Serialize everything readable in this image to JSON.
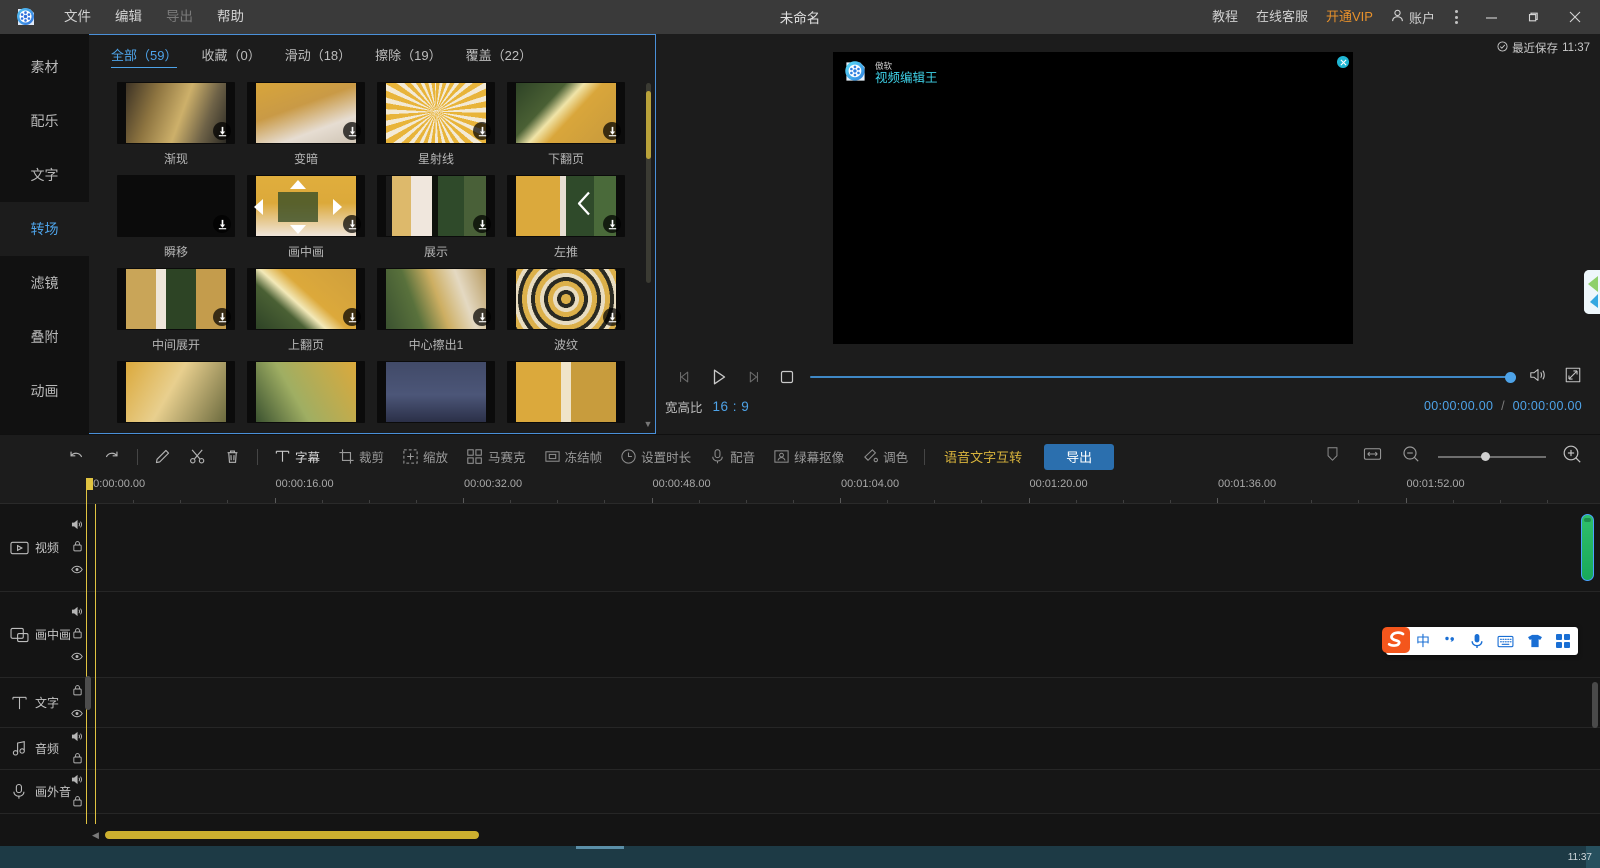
{
  "titlebar": {
    "app_title": "未命名",
    "menus": [
      {
        "label": "文件",
        "disabled": false
      },
      {
        "label": "编辑",
        "disabled": false
      },
      {
        "label": "导出",
        "disabled": true
      },
      {
        "label": "帮助",
        "disabled": false
      }
    ],
    "right": {
      "tutorial": "教程",
      "support": "在线客服",
      "vip": "开通VIP",
      "account": "账户",
      "vip_color": "#e8912b"
    }
  },
  "save_status": {
    "label": "最近保存",
    "time": "11:37"
  },
  "sidebar": {
    "items": [
      {
        "label": "素材",
        "active": false
      },
      {
        "label": "配乐",
        "active": false
      },
      {
        "label": "文字",
        "active": false
      },
      {
        "label": "转场",
        "active": true
      },
      {
        "label": "滤镜",
        "active": false
      },
      {
        "label": "叠附",
        "active": false
      },
      {
        "label": "动画",
        "active": false
      }
    ],
    "active_color": "#4ea3e8"
  },
  "resource_panel": {
    "tabs": [
      {
        "label": "全部（59）",
        "active": true
      },
      {
        "label": "收藏（0）",
        "active": false
      },
      {
        "label": "滑动（18）",
        "active": false
      },
      {
        "label": "擦除（19）",
        "active": false
      },
      {
        "label": "覆盖（22）",
        "active": false
      }
    ],
    "transitions": [
      {
        "name": "渐现",
        "thumb": "fade",
        "download": true
      },
      {
        "name": "变暗",
        "thumb": "darken",
        "download": true
      },
      {
        "name": "星射线",
        "thumb": "starburst",
        "download": true
      },
      {
        "name": "下翻页",
        "thumb": "pagedown",
        "download": true
      },
      {
        "name": "瞬移",
        "thumb": "blurzoom",
        "download": true
      },
      {
        "name": "画中画",
        "thumb": "pip",
        "download": true
      },
      {
        "name": "展示",
        "thumb": "showcase",
        "download": true
      },
      {
        "name": "左推",
        "thumb": "pushleft",
        "download": true
      },
      {
        "name": "中间展开",
        "thumb": "centeropen",
        "download": true
      },
      {
        "name": "上翻页",
        "thumb": "pageup",
        "download": true
      },
      {
        "name": "中心擦出1",
        "thumb": "centerwipe",
        "download": true
      },
      {
        "name": "波纹",
        "thumb": "ripple",
        "download": true
      },
      {
        "name": "",
        "thumb": "row4a",
        "download": false
      },
      {
        "name": "",
        "thumb": "row4b",
        "download": false
      },
      {
        "name": "",
        "thumb": "row4c",
        "download": false
      },
      {
        "name": "",
        "thumb": "row4d",
        "download": false
      }
    ]
  },
  "preview": {
    "watermark": {
      "brand": "傲软",
      "product": "视频编辑王"
    },
    "controls": {
      "prev_frame": "previous-frame",
      "play": "play",
      "next_frame": "next-frame",
      "stop": "stop",
      "volume": "volume",
      "fullscreen": "fullscreen"
    },
    "ratio_label": "宽高比",
    "ratio_value": "16 : 9",
    "current_time": "00:00:00.00",
    "total_time": "00:00:00.00",
    "time_separator": "/",
    "accent": "#4ea3e8"
  },
  "toolbar": {
    "items": [
      {
        "label": "",
        "icon": "undo-icon",
        "type": "icon"
      },
      {
        "label": "",
        "icon": "redo-icon",
        "type": "icon"
      },
      {
        "label": "",
        "icon": "separator",
        "type": "sep"
      },
      {
        "label": "",
        "icon": "edit-pencil-icon",
        "type": "icon"
      },
      {
        "label": "",
        "icon": "scissors-icon",
        "type": "icon"
      },
      {
        "label": "",
        "icon": "trash-icon",
        "type": "icon"
      },
      {
        "label": "",
        "icon": "separator",
        "type": "sep"
      },
      {
        "label": "字幕",
        "icon": "subtitle-icon",
        "type": "text"
      },
      {
        "label": "裁剪",
        "icon": "crop-icon",
        "type": "text"
      },
      {
        "label": "缩放",
        "icon": "scale-icon",
        "type": "text"
      },
      {
        "label": "马赛克",
        "icon": "mosaic-icon",
        "type": "text"
      },
      {
        "label": "冻结帧",
        "icon": "freeze-frame-icon",
        "type": "text"
      },
      {
        "label": "设置时长",
        "icon": "duration-icon",
        "type": "text"
      },
      {
        "label": "配音",
        "icon": "voiceover-icon",
        "type": "text"
      },
      {
        "label": "绿幕抠像",
        "icon": "chroma-key-icon",
        "type": "text"
      },
      {
        "label": "调色",
        "icon": "color-grade-icon",
        "type": "text"
      }
    ],
    "speech_text": "语音文字互转",
    "speech_color": "#d9b43c",
    "export_label": "导出",
    "export_color": "#2b6fae",
    "right_tools": [
      "marker-icon",
      "fit-width-icon",
      "zoom-out-icon",
      "zoom-slider",
      "zoom-in-icon"
    ]
  },
  "timeline": {
    "ruler_ticks": [
      "00:00:00.00",
      "00:00:16.00",
      "00:00:32.00",
      "00:00:48.00",
      "00:01:04.00",
      "00:01:20.00",
      "00:01:36.00",
      "00:01:52.00"
    ],
    "tracks": [
      {
        "name": "视频",
        "icon": "video-track-icon",
        "ctrls": [
          "speaker",
          "lock",
          "eye"
        ]
      },
      {
        "name": "画中画",
        "icon": "pip-track-icon",
        "ctrls": [
          "speaker",
          "lock",
          "eye"
        ]
      },
      {
        "name": "文字",
        "icon": "text-track-icon",
        "ctrls": [
          "lock",
          "eye"
        ]
      },
      {
        "name": "音频",
        "icon": "audio-track-icon",
        "ctrls": [
          "speaker",
          "lock"
        ]
      },
      {
        "name": "画外音",
        "icon": "voiceover-track-icon",
        "ctrls": [
          "speaker",
          "lock"
        ]
      }
    ],
    "playhead_color": "#e0c341",
    "scrollbar_color": "#cdb02f"
  },
  "ime": {
    "items": [
      "sogou-logo",
      "中",
      "punctuation-icon",
      "mic-icon",
      "keyboard-icon",
      "skin-icon",
      "grid-icon"
    ],
    "mode_label": "中"
  },
  "taskbar": {
    "clock": "11:37"
  }
}
